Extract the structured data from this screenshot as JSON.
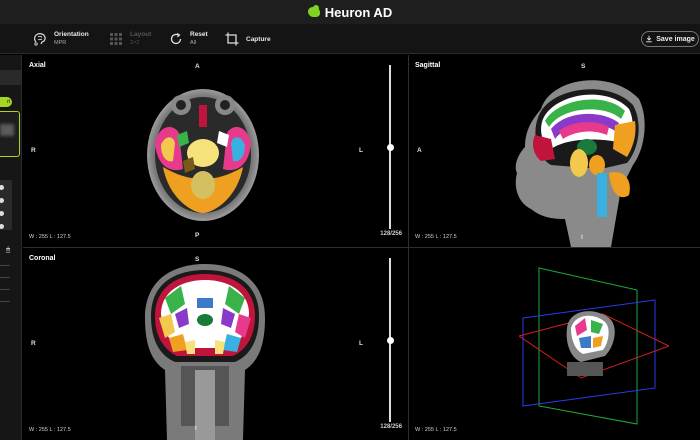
{
  "app": {
    "title": "Heuron AD"
  },
  "toolbar": {
    "orientation": {
      "label": "Orientation",
      "value": "MPR",
      "icon": "brain-orientation-icon"
    },
    "layout": {
      "label": "Layout",
      "value": "2×2",
      "icon": "grid-icon",
      "disabled": true
    },
    "reset": {
      "label": "Reset",
      "value": "All",
      "icon": "reset-icon"
    },
    "capture": {
      "label": "Capture",
      "icon": "crop-icon"
    },
    "save_image": {
      "label": "Save image",
      "icon": "download-icon"
    }
  },
  "sidebar": {
    "pill_label": "rt",
    "mouse_icon": "mouse-icon"
  },
  "viewports": {
    "axial": {
      "title": "Axial",
      "top": "A",
      "bottom": "P",
      "left": "R",
      "right": "L",
      "window_level": "W : 255  L : 127.5",
      "slice": "128/256",
      "slider_fraction": 0.5
    },
    "sagittal": {
      "title": "Sagittal",
      "top": "S",
      "left": "A",
      "bottom": "I",
      "window_level": "W : 255  L : 127.5"
    },
    "coronal": {
      "title": "Coronal",
      "top": "S",
      "bottom": "I",
      "left": "R",
      "right": "L",
      "window_level": "W : 255  L : 127.5",
      "slice": "128/256",
      "slider_fraction": 0.5
    },
    "three_d": {
      "window_level": "W : 255  L : 127.5"
    }
  },
  "colors": {
    "accent": "#a5d623",
    "brand": "#7ed321"
  }
}
